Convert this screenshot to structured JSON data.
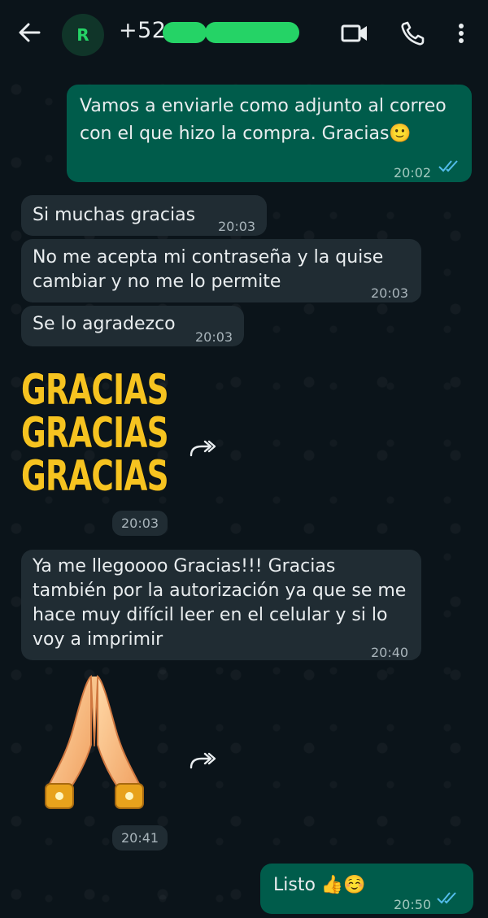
{
  "header": {
    "back_icon": "arrow-left-icon",
    "avatar_letter": "R",
    "contact_prefix": "+52",
    "video_icon": "video-camera-icon",
    "call_icon": "phone-icon",
    "menu_icon": "more-vertical-icon"
  },
  "messages": [
    {
      "direction": "out",
      "text": "Vamos a enviarle como adjunto al correo con el que hizo la compra. Gracias🙂",
      "time": "20:02",
      "status": "read"
    },
    {
      "direction": "in",
      "text": "Si muchas gracias",
      "time": "20:03"
    },
    {
      "direction": "in",
      "text": "No me acepta mi contraseña y la quise cambiar y no me lo permite",
      "time": "20:03"
    },
    {
      "direction": "in",
      "text": "Se lo agradezco",
      "time": "20:03"
    },
    {
      "direction": "in",
      "type": "sticker",
      "sticker_text": [
        "GRACIAS",
        "GRACIAS",
        "GRACIAS"
      ],
      "time": "20:03"
    },
    {
      "direction": "in",
      "text": "Ya me llegoooo Gracias!!! Gracias también por la autorización ya que se me hace muy difícil leer en el celular y si lo voy a imprimir",
      "time": "20:40"
    },
    {
      "direction": "in",
      "type": "sticker",
      "sticker_icon": "praying-hands-icon",
      "time": "20:41"
    },
    {
      "direction": "out",
      "text": "Listo 👍☺️",
      "time": "20:50",
      "status": "read"
    }
  ],
  "colors": {
    "background": "#0b141a",
    "incoming_bubble": "#202c33",
    "outgoing_bubble": "#005c4b",
    "accent": "#25d366",
    "read_ticks": "#53bdeb",
    "sticker_yellow": "#f6c320"
  }
}
